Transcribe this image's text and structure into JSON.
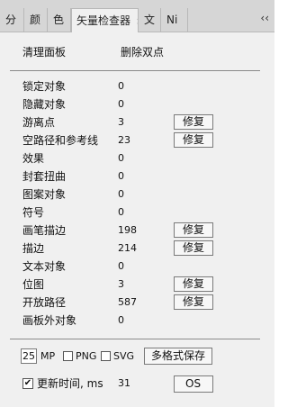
{
  "tabs": [
    {
      "label": "分",
      "active": false
    },
    {
      "label": "颜",
      "active": false
    },
    {
      "label": "色",
      "active": false
    },
    {
      "label": "矢量检查器",
      "active": true,
      "close": "×"
    },
    {
      "label": "文",
      "active": false
    },
    {
      "label": "Ni",
      "active": false
    }
  ],
  "collapse_glyph": "‹‹",
  "panel": {
    "clean_label": "清理面板",
    "delete_duplicates": "删除双点",
    "fix_label": "修复",
    "rows": [
      {
        "label": "锁定对象",
        "count": "0",
        "fix": false
      },
      {
        "label": "隐藏对象",
        "count": "0",
        "fix": false
      },
      {
        "label": "游离点",
        "count": "3",
        "fix": true
      },
      {
        "label": "空路径和参考线",
        "count": "23",
        "fix": true
      },
      {
        "label": "效果",
        "count": "0",
        "fix": false
      },
      {
        "label": "封套扭曲",
        "count": "0",
        "fix": false
      },
      {
        "label": "图案对象",
        "count": "0",
        "fix": false
      },
      {
        "label": "符号",
        "count": "0",
        "fix": false
      },
      {
        "label": "画笔描边",
        "count": "198",
        "fix": true
      },
      {
        "label": "描边",
        "count": "214",
        "fix": true
      },
      {
        "label": "文本对象",
        "count": "0",
        "fix": false
      },
      {
        "label": "位图",
        "count": "3",
        "fix": true
      },
      {
        "label": "开放路径",
        "count": "587",
        "fix": true
      },
      {
        "label": "画板外对象",
        "count": "0",
        "fix": false
      }
    ]
  },
  "export": {
    "mp_value": "25",
    "mp_label": "MP",
    "png_label": "PNG",
    "png_checked": false,
    "svg_label": "SVG",
    "svg_checked": false,
    "save_button": "多格式保存"
  },
  "update": {
    "checked": true,
    "label": "更新时间, ms",
    "value": "31",
    "button_visible": "OS"
  }
}
